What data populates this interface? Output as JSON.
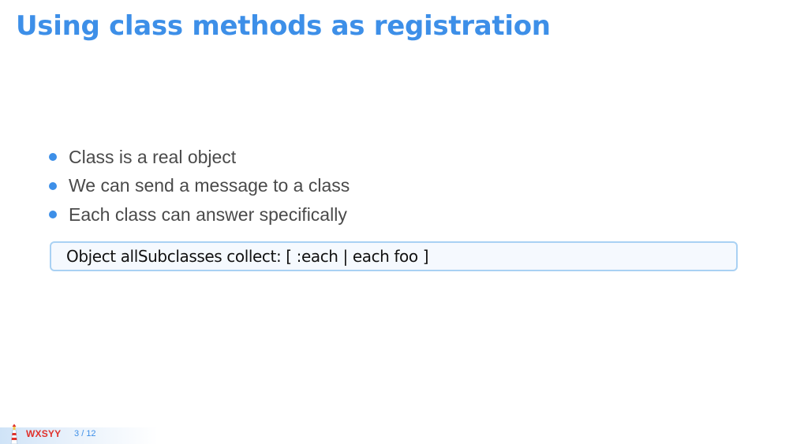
{
  "slide": {
    "title": "Using class methods as registration",
    "bullets": [
      "Class is a real object",
      "We can send a message to a class",
      "Each class can answer specifically"
    ],
    "code": "Object allSubclasses collect: [ :each | each foo ]"
  },
  "footer": {
    "logo_icon": "lighthouse-icon",
    "brand": "WXSYY",
    "page_current": "3",
    "page_separator": "/",
    "page_total": "12"
  },
  "colors": {
    "accent": "#3d8fe8",
    "brand_red": "#e0312b",
    "code_border": "#a9d1f3",
    "text": "#4a4a4a"
  }
}
